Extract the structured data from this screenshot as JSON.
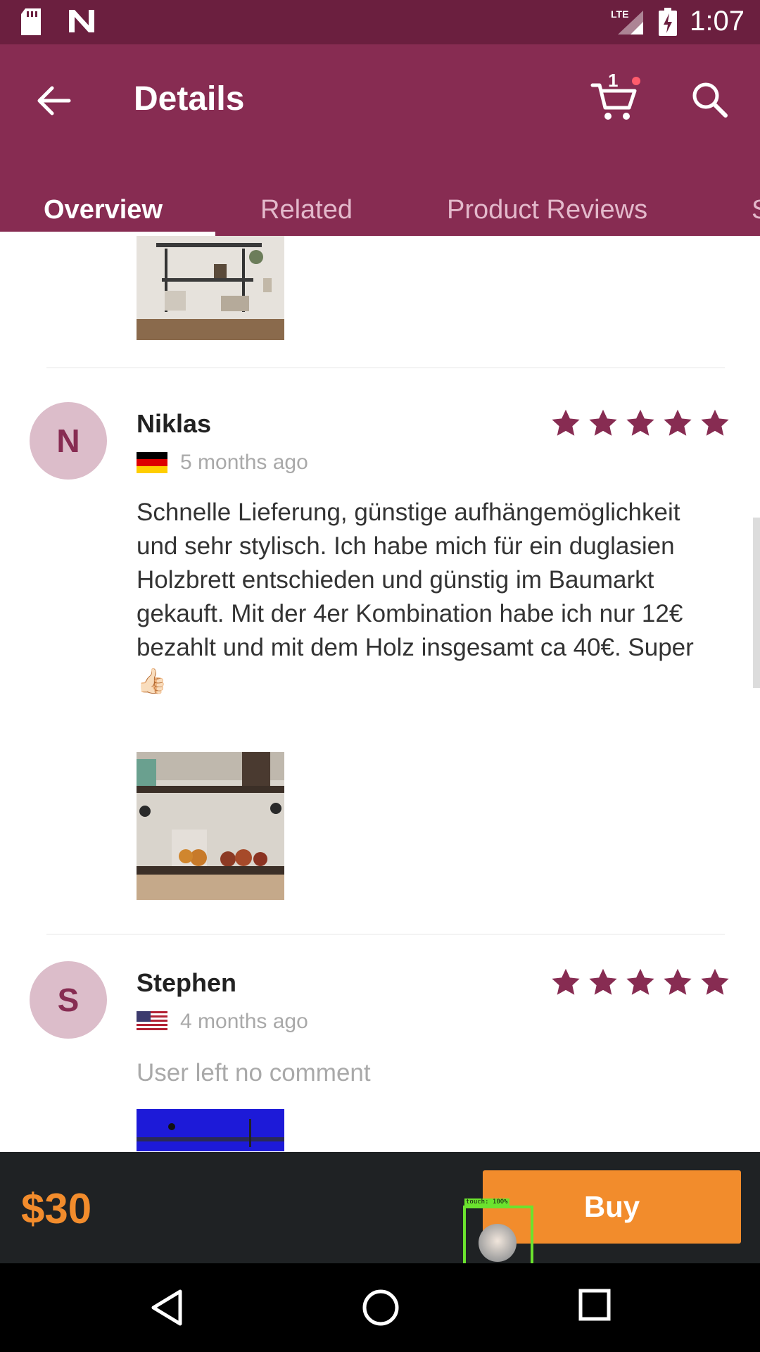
{
  "status_bar": {
    "time": "1:07",
    "network": "LTE"
  },
  "app_bar": {
    "title": "Details",
    "cart_count": "1"
  },
  "tabs": [
    {
      "label": "Overview",
      "active": true
    },
    {
      "label": "Related",
      "active": false
    },
    {
      "label": "Product Reviews",
      "active": false
    },
    {
      "label": "S",
      "active": false
    }
  ],
  "reviews": [
    {
      "name": "Niklas",
      "avatar_letter": "N",
      "rating": 5,
      "country_flag": "germany-flag",
      "time_ago": "5 months ago",
      "text": "Schnelle Lieferung, günstige aufhängemöglichkeit und sehr stylisch. Ich habe mich für ein duglasien Holzbrett entschieden und günstig im Baumarkt gekauft. Mit der 4er Kombination habe ich nur 12€ bezahlt und mit dem Holz insgesamt ca 40€. Super 👍🏻"
    },
    {
      "name": "Stephen",
      "avatar_letter": "S",
      "rating": 5,
      "country_flag": "usa-flag",
      "time_ago": "4 months ago",
      "text": "User left no comment"
    }
  ],
  "purchase_bar": {
    "price": "$30",
    "buy_label": "Buy"
  },
  "touch_indicator": {
    "label": "touch: 100%"
  },
  "colors": {
    "primary": "#872c52",
    "status_bar": "#6b1f3f",
    "accent": "#f28c2c",
    "star": "#872c52"
  }
}
